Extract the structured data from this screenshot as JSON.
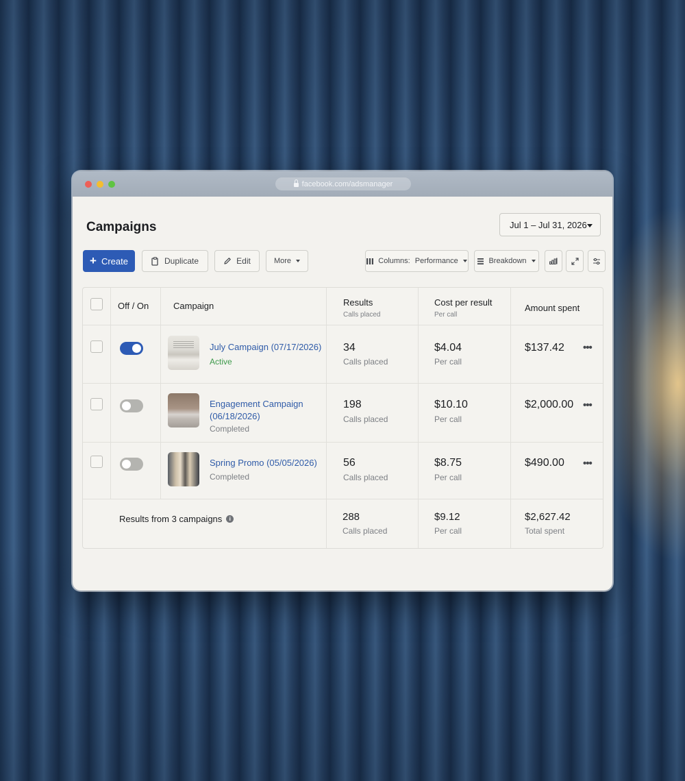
{
  "browser": {
    "url": "facebook.com/adsmanager"
  },
  "page": {
    "title": "Campaigns",
    "date_range": "Jul 1 – Jul 31, 2026"
  },
  "toolbar": {
    "create": "Create",
    "duplicate": "Duplicate",
    "edit": "Edit",
    "more": "More",
    "columns_label": "Columns:",
    "columns_value": "Performance",
    "breakdown": "Breakdown"
  },
  "table": {
    "headers": {
      "off_on": "Off / On",
      "campaign": "Campaign",
      "results": "Results",
      "results_sub": "Calls placed",
      "cost": "Cost per result",
      "cost_sub": "Per call",
      "amount": "Amount spent"
    },
    "rows": [
      {
        "name": "July Campaign (07/17/2026)",
        "status": "Active",
        "on": true,
        "results": "34",
        "results_sub": "Calls placed",
        "cost": "$4.04",
        "cost_sub": "Per call",
        "amount": "$137.42"
      },
      {
        "name": "Engagement Campaign (06/18/2026)",
        "status": "Completed",
        "on": false,
        "results": "198",
        "results_sub": "Calls placed",
        "cost": "$10.10",
        "cost_sub": "Per call",
        "amount": "$2,000.00"
      },
      {
        "name": "Spring Promo (05/05/2026)",
        "status": "Completed",
        "on": false,
        "results": "56",
        "results_sub": "Calls placed",
        "cost": "$8.75",
        "cost_sub": "Per call",
        "amount": "$490.00"
      }
    ],
    "summary": {
      "label": "Results from 3 campaigns",
      "results": "288",
      "results_sub": "Calls placed",
      "cost": "$9.12",
      "cost_sub": "Per call",
      "amount": "$2,627.42",
      "amount_sub": "Total spent"
    }
  },
  "colors": {
    "accent": "#2d5bb5",
    "active": "#3e9a4b",
    "link": "#2f5ba8"
  }
}
